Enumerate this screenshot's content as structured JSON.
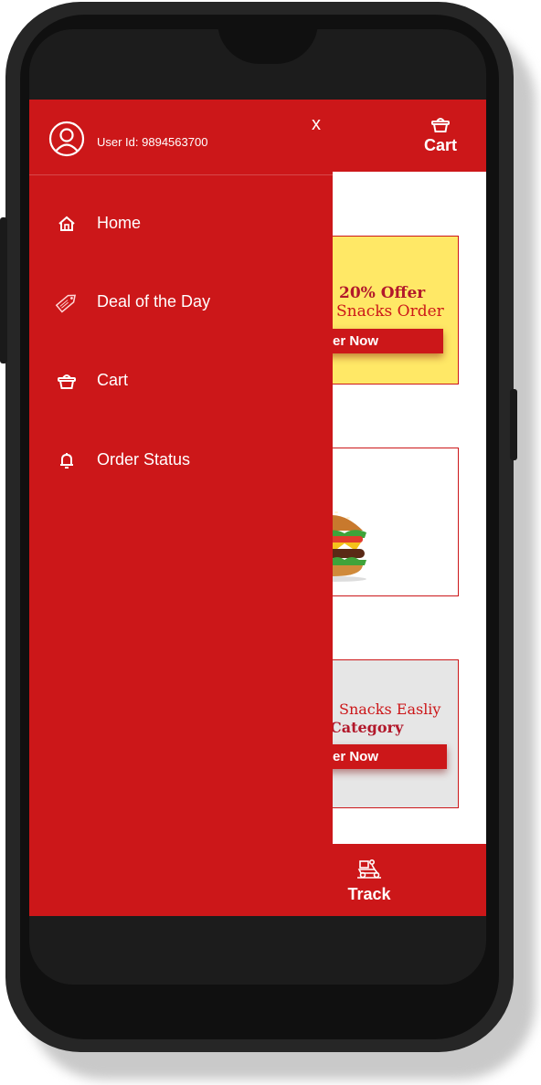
{
  "colors": {
    "brand_red": "#cc1719",
    "offer_yellow": "#ffe866",
    "phone_body": "#262626"
  },
  "header": {
    "cart_label": "Cart",
    "cart_icon": "basket-icon"
  },
  "drawer": {
    "user_id": "User Id: 9894563700",
    "close_label": "x",
    "items": [
      {
        "label": "Home",
        "icon": "home-icon"
      },
      {
        "label": "Deal of the Day",
        "icon": "tag-icon"
      },
      {
        "label": "Cart",
        "icon": "basket-icon"
      },
      {
        "label": "Order Status",
        "icon": "bell-icon"
      }
    ]
  },
  "cards": [
    {
      "title": "20% Offer",
      "subtitle": "Snacks Order",
      "button": "rder Now"
    },
    {
      "image": "burger-and-drink"
    },
    {
      "subtitle": "Snacks Easliy",
      "title": "Category",
      "button": "rder Now"
    }
  ],
  "footer": {
    "track_label": "Track",
    "track_icon": "delivery-scooter-icon"
  }
}
